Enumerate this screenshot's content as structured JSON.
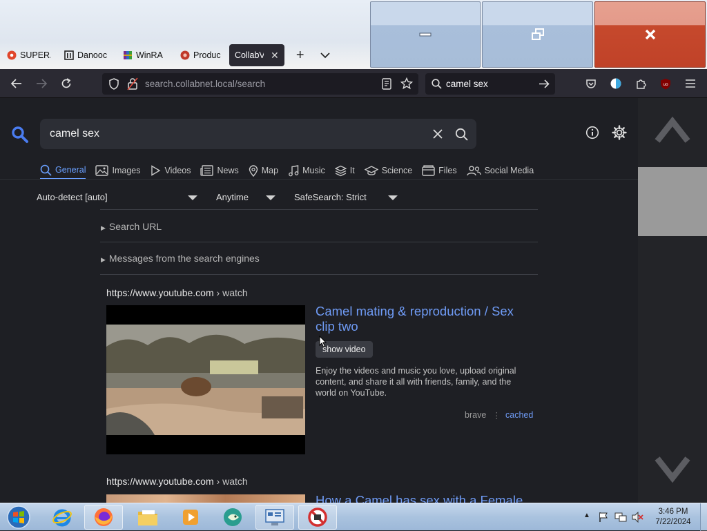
{
  "browser": {
    "tabs": [
      {
        "label": "SUPERA",
        "icon": "ubuntu-like-icon",
        "color": "#e0452b"
      },
      {
        "label": "Danooc",
        "icon": "archive-icon",
        "color": "#222222"
      },
      {
        "label": "WinRA",
        "icon": "winrar-icon",
        "color": "#7a2b8f"
      },
      {
        "label": "Produc",
        "icon": "product-icon",
        "color": "#c0392b"
      }
    ],
    "active_tab": {
      "label": "CollabVM"
    },
    "url": "search.collabnet.local/search",
    "search_bar_value": "camel sex"
  },
  "search": {
    "query": "camel sex",
    "categories": [
      {
        "label": "General",
        "icon": "search-icon",
        "active": true
      },
      {
        "label": "Images",
        "icon": "image-icon"
      },
      {
        "label": "Videos",
        "icon": "play-icon"
      },
      {
        "label": "News",
        "icon": "newspaper-icon"
      },
      {
        "label": "Map",
        "icon": "map-pin-icon"
      },
      {
        "label": "Music",
        "icon": "music-icon"
      },
      {
        "label": "It",
        "icon": "layers-icon"
      },
      {
        "label": "Science",
        "icon": "graduation-icon"
      },
      {
        "label": "Files",
        "icon": "files-icon"
      },
      {
        "label": "Social Media",
        "icon": "people-icon"
      }
    ],
    "filters": {
      "language": "Auto-detect [auto]",
      "time": "Anytime",
      "safesearch": "SafeSearch: Strict"
    },
    "details": {
      "search_url": "Search URL",
      "messages": "Messages from the search engines"
    },
    "results": [
      {
        "url": "https://www.youtube.com",
        "crumb": "› watch",
        "title": "Camel mating & reproduction / Sex clip two",
        "title_line1": "Camel mating & reproduction / Sex",
        "title_line2": "clip two",
        "show_video": "show video",
        "snippet": "Enjoy the videos and music you love, upload original content, and share it all with friends, family, and the world on YouTube.",
        "snippet_lines": [
          "Enjoy the videos and music you love, upload original",
          "content, and share it all with friends, family, and the",
          "world on YouTube."
        ],
        "engine": "brave",
        "cached": "cached"
      },
      {
        "url": "https://www.youtube.com",
        "crumb": "› watch",
        "title": "How a Camel has sex with a Female"
      }
    ]
  },
  "taskbar": {
    "time": "3:46 PM",
    "date": "7/22/2024"
  },
  "colors": {
    "link": "#6f9bf5",
    "accent": "#6aa0ff",
    "page_bg": "#1e1f24"
  }
}
